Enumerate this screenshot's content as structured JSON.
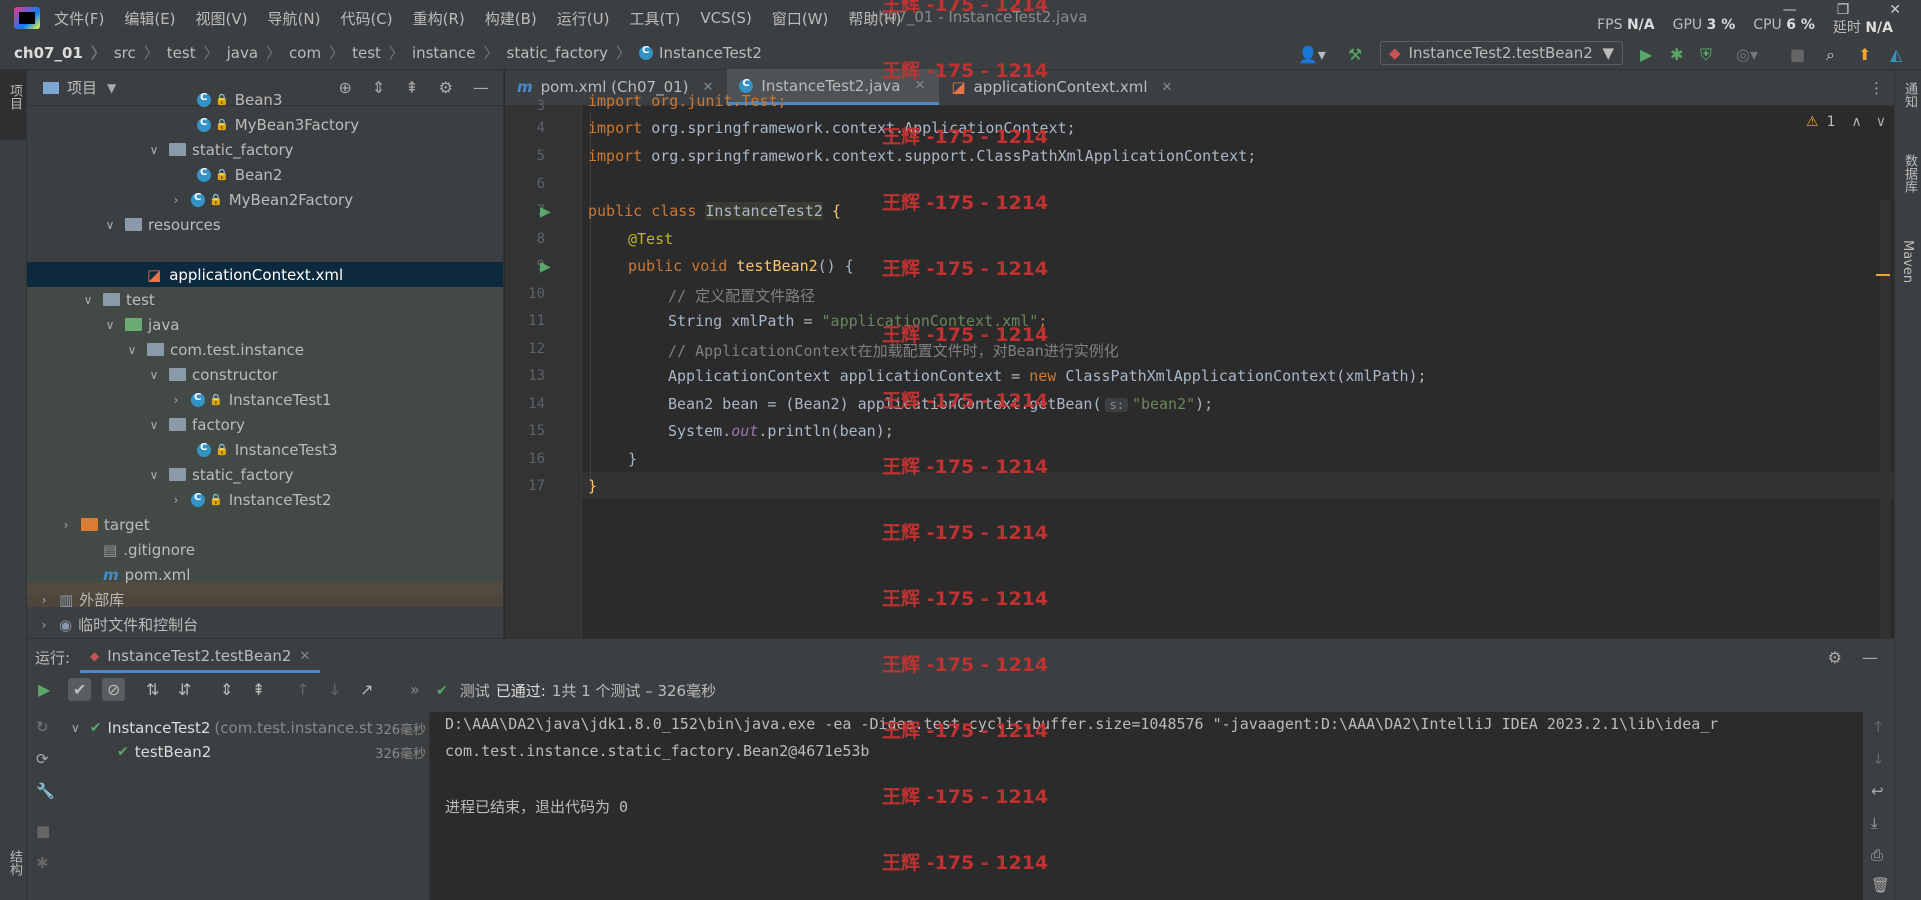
{
  "menubar": {
    "items": [
      "文件(F)",
      "编辑(E)",
      "视图(V)",
      "导航(N)",
      "代码(C)",
      "重构(R)",
      "构建(B)",
      "运行(U)",
      "工具(T)",
      "VCS(S)",
      "窗口(W)",
      "帮助(H)"
    ],
    "window_title": "ch07_01 - InstanceTest2.java",
    "fps_label": "FPS",
    "fps_value": "N/A",
    "gpu_label": "GPU",
    "gpu_value": "3 %",
    "cpu_label": "CPU",
    "cpu_value": "6 %",
    "latency_label": "延时",
    "latency_value": "N/A"
  },
  "breadcrumb": [
    "ch07_01",
    "src",
    "test",
    "java",
    "com",
    "test",
    "instance",
    "static_factory",
    "InstanceTest2"
  ],
  "run_config": "InstanceTest2.testBean2",
  "left_stripe": {
    "project_label": "项目",
    "structure_label": "结构"
  },
  "right_stripe": {
    "notify_label": "通知",
    "database_label": "数据库",
    "maven_label": "Maven"
  },
  "project_panel": {
    "title": "项目",
    "rows": [
      {
        "label": "Bean3"
      },
      {
        "label": "MyBean3Factory"
      },
      {
        "label": "static_factory"
      },
      {
        "label": "Bean2"
      },
      {
        "label": "MyBean2Factory"
      },
      {
        "label": "resources"
      },
      {
        "label": "applicationContext.xml"
      },
      {
        "label": "test"
      },
      {
        "label": "java"
      },
      {
        "label": "com.test.instance"
      },
      {
        "label": "constructor"
      },
      {
        "label": "InstanceTest1"
      },
      {
        "label": "factory"
      },
      {
        "label": "InstanceTest3"
      },
      {
        "label": "static_factory"
      },
      {
        "label": "InstanceTest2"
      },
      {
        "label": "target"
      },
      {
        "label": ".gitignore"
      },
      {
        "label": "pom.xml"
      },
      {
        "label": "外部库"
      },
      {
        "label": "临时文件和控制台"
      }
    ]
  },
  "editor_tabs": [
    {
      "label": "pom.xml (Ch07_01)"
    },
    {
      "label": "InstanceTest2.java"
    },
    {
      "label": "applicationContext.xml"
    }
  ],
  "editor": {
    "warning_count": "1",
    "line_numbers": [
      "3",
      "4",
      "5",
      "6",
      "7",
      "8",
      "9",
      "10",
      "11",
      "12",
      "13",
      "14",
      "15",
      "16",
      "17"
    ],
    "lines": {
      "l3": "import org.junit.Test;",
      "l4_kw": "import",
      "l4_rest": " org.springframework.context.ApplicationContext;",
      "l5_kw": "import",
      "l5_rest": " org.springframework.context.support.ClassPathXmlApplicationContext;",
      "l7_kw": "public class ",
      "l7_name": "InstanceTest2",
      "l7_brace": " {",
      "l8": "@Test",
      "l9_kw": "public void ",
      "l9_fn": "testBean2",
      "l9_rest": "() {",
      "l10": "// 定义配置文件路径",
      "l11_a": "String xmlPath = ",
      "l11_str": "\"applicationContext.xml\"",
      "l11_b": ";",
      "l12": "// ApplicationContext在加载配置文件时，对Bean进行实例化",
      "l13_a": "ApplicationContext applicationContext = ",
      "l13_kw": "new",
      "l13_b": " ClassPathXmlApplicationContext(xmlPath);",
      "l14_a": "Bean2 bean = (Bean2) applicationContext.getBean(",
      "l14_hint": "s:",
      "l14_str": "\"bean2\"",
      "l14_b": ");",
      "l15_a": "System.",
      "l15_out": "out",
      "l15_b": ".println(bean);",
      "l16": "}",
      "l17": "}"
    }
  },
  "run_panel": {
    "label": "运行:",
    "tab": "InstanceTest2.testBean2",
    "status_prefix": "测试",
    "status_pass": "已通过:",
    "status_rest": "1共 1 个测试 – 326毫秒",
    "tree": [
      {
        "name": "InstanceTest2",
        "pkg": "(com.test.instance.st",
        "time": "326毫秒"
      },
      {
        "name": "testBean2",
        "pkg": "",
        "time": "326毫秒"
      }
    ],
    "console": [
      "D:\\AAA\\DA2\\java\\jdk1.8.0_152\\bin\\java.exe -ea -Didea.test.cyclic.buffer.size=1048576 \"-javaagent:D:\\AAA\\DA2\\IntelliJ IDEA 2023.2.1\\lib\\idea_r",
      "com.test.instance.static_factory.Bean2@4671e53b",
      "",
      "进程已结束，退出代码为 0"
    ]
  },
  "watermark": "王辉 -175 - 1214",
  "colors": {
    "accent": "#4a88c7",
    "pass": "#59a869",
    "keyword": "#cc7832",
    "string": "#6a8759",
    "watermark": "#c83232"
  }
}
